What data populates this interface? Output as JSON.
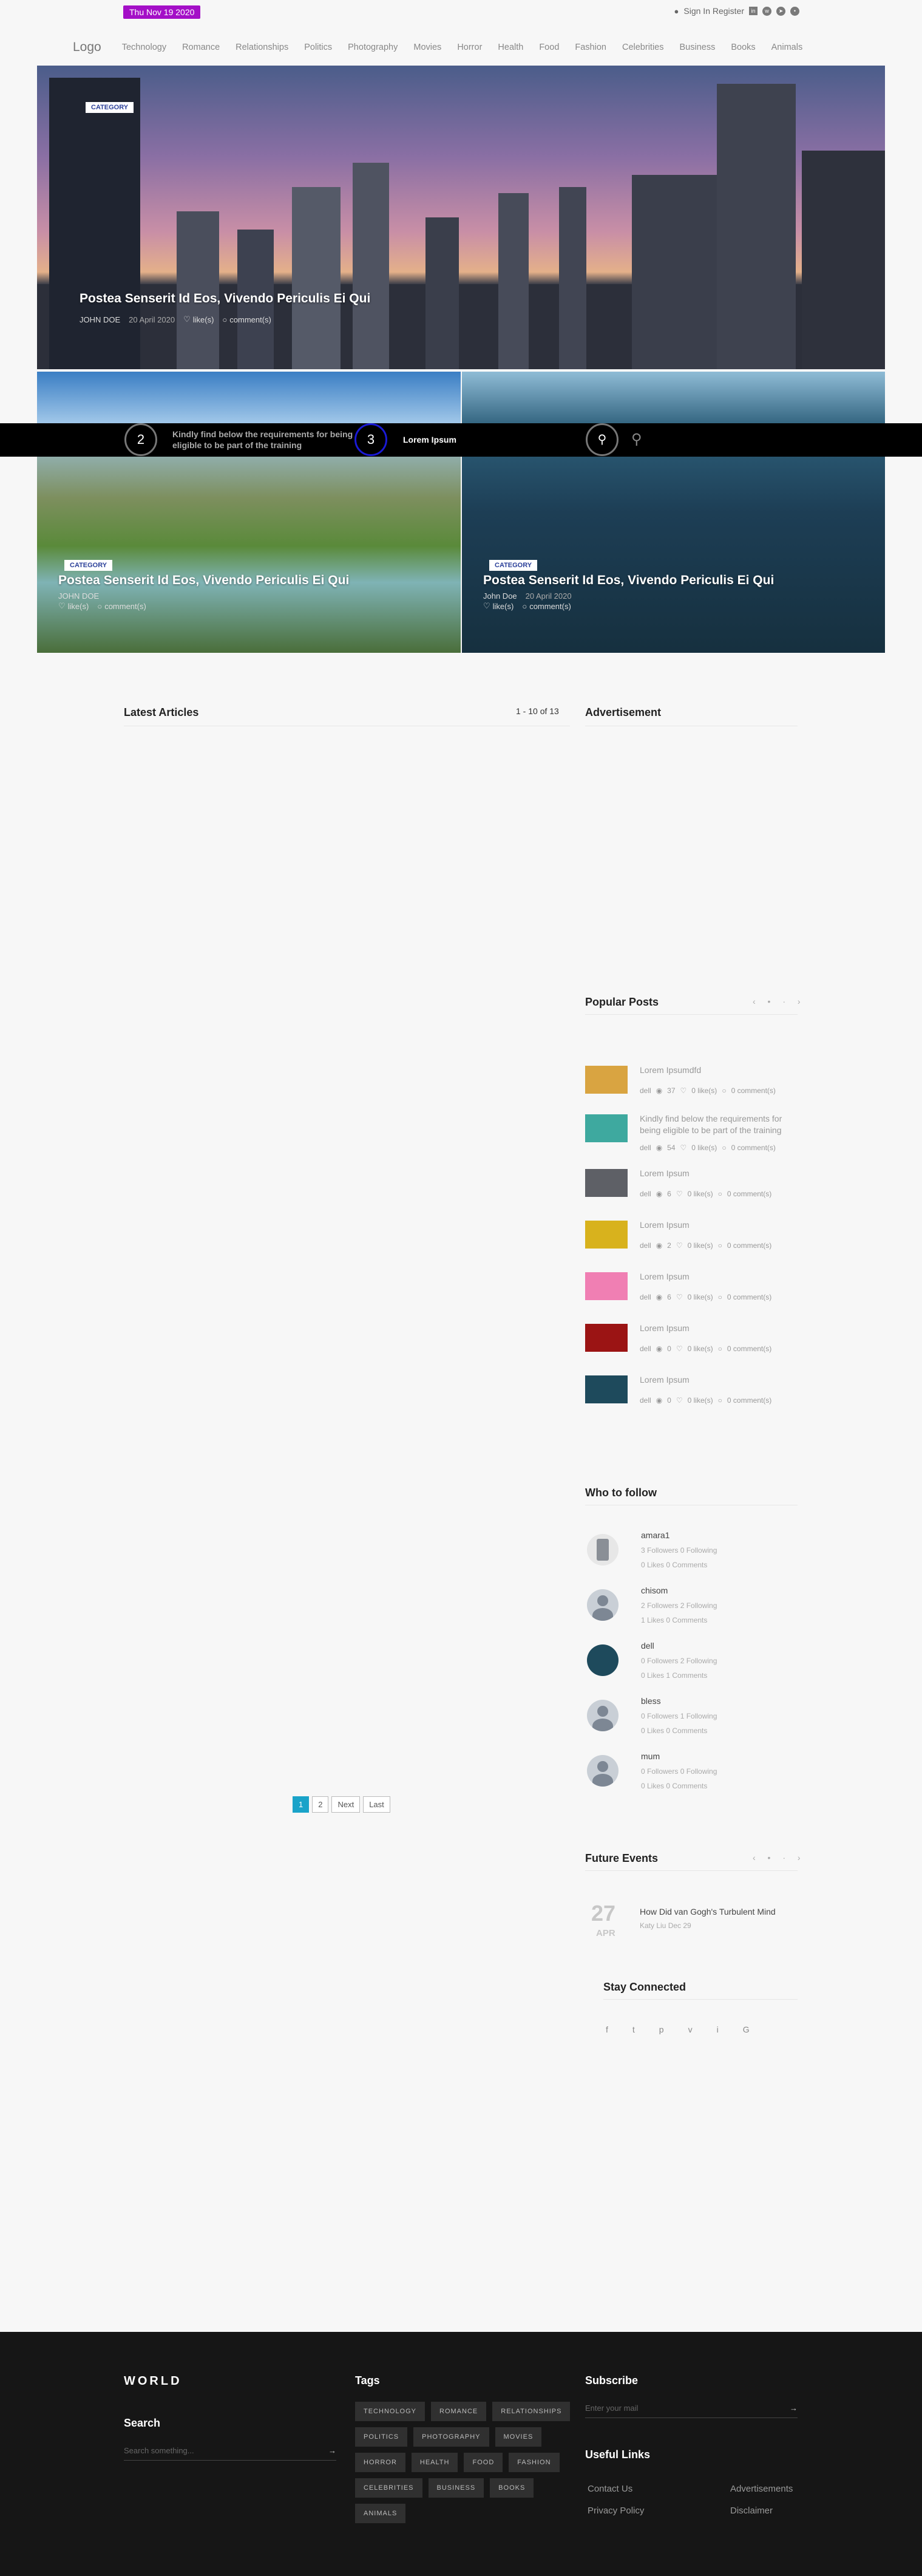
{
  "topbar": {
    "date": "Thu Nov 19 2020",
    "auth": "Sign In Register"
  },
  "nav": {
    "logo": "Logo",
    "items": [
      "Technology",
      "Romance",
      "Relationships",
      "Politics",
      "Photography",
      "Movies",
      "Horror",
      "Health",
      "Food",
      "Fashion",
      "Celebrities",
      "Business",
      "Books",
      "Animals"
    ]
  },
  "hero": {
    "category": "CATEGORY",
    "title": "Postea Senserit Id Eos, Vivendo Periculis Ei Qui",
    "author": "JOHN DOE",
    "date": "20 April 2020",
    "likes": "like(s)",
    "comments": "comment(s)"
  },
  "tiles": [
    {
      "category": "CATEGORY",
      "title": "Postea Senserit Id Eos, Vivendo Periculis Ei Qui",
      "author": "JOHN DOE",
      "likes": "like(s)",
      "comments": "comment(s)"
    },
    {
      "category": "CATEGORY",
      "title": "Postea Senserit Id Eos, Vivendo Periculis Ei Qui",
      "author": "John Doe",
      "date": "20 April 2020",
      "likes": "like(s)",
      "comments": "comment(s)"
    }
  ],
  "strip": {
    "num2": "2",
    "text2": "Kindly find below the requirements for being eligible to be part of the training",
    "num3": "3",
    "text3": "Lorem Ipsum"
  },
  "latest": {
    "title": "Latest Articles",
    "count": "1 - 10 of 13"
  },
  "pagination": [
    "1",
    "2",
    "Next",
    "Last"
  ],
  "advertisement": {
    "title": "Advertisement"
  },
  "popular": {
    "title": "Popular Posts",
    "items": [
      {
        "title": "Lorem Ipsumdfd",
        "author": "dell",
        "views": "37",
        "likes": "0 like(s)",
        "comments": "0 comment(s)",
        "thumb": "#d9a441"
      },
      {
        "title": "Kindly find below the requirements for being eligible to be part of the training",
        "author": "dell",
        "views": "54",
        "likes": "0 like(s)",
        "comments": "0 comment(s)",
        "thumb": "#3ea99f"
      },
      {
        "title": "Lorem Ipsum",
        "author": "dell",
        "views": "6",
        "likes": "0 like(s)",
        "comments": "0 comment(s)",
        "thumb": "#5e6066"
      },
      {
        "title": "Lorem Ipsum",
        "author": "dell",
        "views": "2",
        "likes": "0 like(s)",
        "comments": "0 comment(s)",
        "thumb": "#d8b21d"
      },
      {
        "title": "Lorem Ipsum",
        "author": "dell",
        "views": "6",
        "likes": "0 like(s)",
        "comments": "0 comment(s)",
        "thumb": "#f07fb3"
      },
      {
        "title": "Lorem Ipsum",
        "author": "dell",
        "views": "0",
        "likes": "0 like(s)",
        "comments": "0 comment(s)",
        "thumb": "#9b1414"
      },
      {
        "title": "Lorem Ipsum",
        "author": "dell",
        "views": "0",
        "likes": "0 like(s)",
        "comments": "0 comment(s)",
        "thumb": "#1e4a5c"
      }
    ]
  },
  "who_to_follow": {
    "title": "Who to follow",
    "users": [
      {
        "name": "amara1",
        "l1": "3 Followers 0 Following",
        "l2": "0 Likes 0 Comments",
        "avatar": "#8a8f96"
      },
      {
        "name": "chisom",
        "l1": "2 Followers 2 Following",
        "l2": "1 Likes 0 Comments",
        "avatar": "#c9cfd6"
      },
      {
        "name": "dell",
        "l1": "0 Followers 2 Following",
        "l2": "0 Likes 1 Comments",
        "avatar": "#1e4a5c"
      },
      {
        "name": "bless",
        "l1": "0 Followers 1 Following",
        "l2": "0 Likes 0 Comments",
        "avatar": "#c9cfd6"
      },
      {
        "name": "mum",
        "l1": "0 Followers 0 Following",
        "l2": "0 Likes 0 Comments",
        "avatar": "#c9cfd6"
      }
    ]
  },
  "events": {
    "title": "Future Events",
    "day": "27",
    "month": "APR",
    "event_title": "How Did van Gogh's Turbulent Mind",
    "event_meta": "Katy Liu Dec 29"
  },
  "stay_connected": {
    "title": "Stay Connected",
    "icons": [
      "f",
      "t",
      "p",
      "v",
      "i",
      "G"
    ]
  },
  "footer": {
    "brand": "WORLD",
    "search_title": "Search",
    "search_placeholder": "Search something...",
    "tags_title": "Tags",
    "tags": [
      "TECHNOLOGY",
      "ROMANCE",
      "RELATIONSHIPS",
      "POLITICS",
      "PHOTOGRAPHY",
      "MOVIES",
      "HORROR",
      "HEALTH",
      "FOOD",
      "FASHION",
      "CELEBRITIES",
      "BUSINESS",
      "BOOKS",
      "ANIMALS"
    ],
    "subscribe_title": "Subscribe",
    "subscribe_placeholder": "Enter your mail",
    "links_title": "Useful Links",
    "links": [
      "Contact Us",
      "Advertisements",
      "Privacy Policy",
      "Disclaimer"
    ]
  },
  "colors": {
    "accent": "#a40fc7",
    "active_page": "#1aa3c9",
    "footer_bg": "#161616"
  }
}
